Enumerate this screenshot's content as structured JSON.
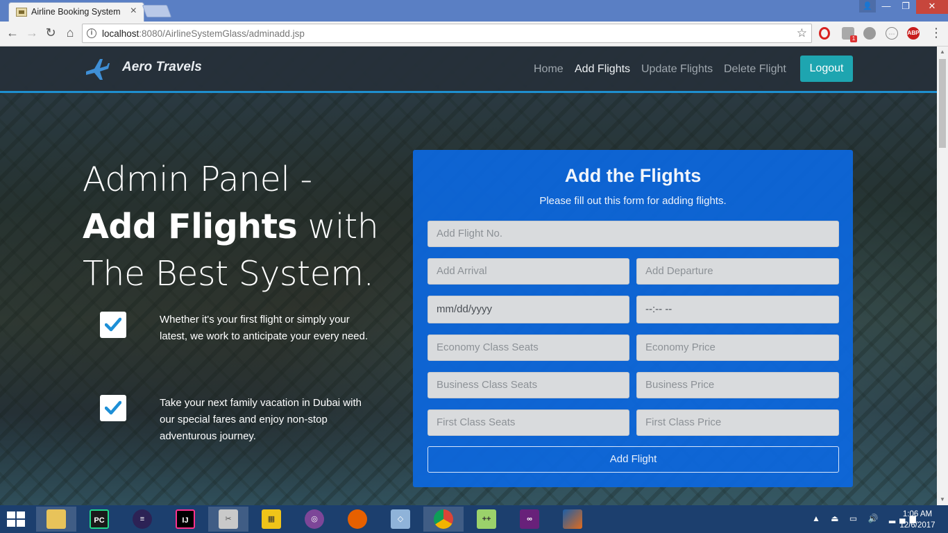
{
  "browser": {
    "tab_title": "Airline Booking System",
    "url_host": "localhost",
    "url_rest": ":8080/AirlineSystemGlass/adminadd.jsp",
    "shield_badge": "1",
    "abp_label": "ABP"
  },
  "navbar": {
    "brand": "Aero Travels",
    "links": [
      {
        "label": "Home"
      },
      {
        "label": "Add Flights"
      },
      {
        "label": "Update Flights"
      },
      {
        "label": "Delete Flight"
      }
    ],
    "logout": "Logout"
  },
  "hero": {
    "line1": "Admin Panel -",
    "line2_bold": "Add Flights",
    "line2_rest": " with",
    "line3": "The Best System."
  },
  "features": [
    {
      "text": "Whether it's your first flight or simply your latest, we work to anticipate your every need."
    },
    {
      "text": "Take your next family vacation in Dubai with our special fares and enjoy non-stop adventurous journey."
    }
  ],
  "form": {
    "title": "Add the Flights",
    "subtitle": "Please fill out this form for adding flights.",
    "flight_no": "Add Flight No.",
    "arrival": "Add Arrival",
    "departure": "Add Departure",
    "date": "mm/dd/yyyy",
    "time": "--:-- --",
    "economy_seats": "Economy Class Seats",
    "economy_price": "Economy Price",
    "business_seats": "Business Class Seats",
    "business_price": "Business Price",
    "first_seats": "First Class Seats",
    "first_price": "First Class Price",
    "submit": "Add Flight"
  },
  "taskbar": {
    "apps": [
      "file-explorer",
      "pycharm",
      "eclipse",
      "intellij",
      "tools",
      "toolbox",
      "tor-browser",
      "firefox",
      "virtualbox",
      "chrome",
      "notepad-plus-plus",
      "visual-studio",
      "matlab"
    ],
    "time": "1:06 AM",
    "date": "12/6/2017"
  },
  "colors": {
    "accent": "#1e8fcf",
    "form_bg": "#0c68e0",
    "logout_bg": "#1ea5b0"
  }
}
